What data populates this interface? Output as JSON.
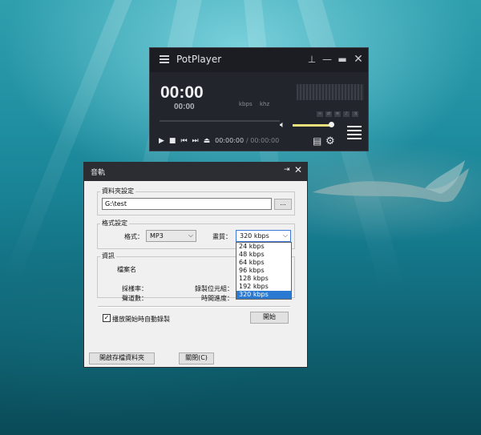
{
  "potplayer": {
    "title": "PotPlayer",
    "time_main": "00:00",
    "time_sub": "00:00",
    "unit_kbps": "kbps",
    "unit_khz": "khz",
    "time_current": "00:00:00",
    "time_total": "/ 00:00:00",
    "volume_level": 0.95,
    "icons": [
      "menu-icon",
      "pin-icon",
      "minimize-icon",
      "maximize-icon",
      "close-icon",
      "play-icon",
      "stop-icon",
      "previous-icon",
      "next-icon",
      "eject-icon",
      "volume-icon",
      "playlist-icon",
      "subtitle-icon",
      "settings-icon"
    ]
  },
  "dialog": {
    "title": "音軌",
    "folder_group": "資料夾設定",
    "folder_path": "G:\\test",
    "browse_label": "...",
    "format_group": "格式設定",
    "format_label": "格式：",
    "format_value": "MP3",
    "quality_label": "畫質：",
    "quality_value": "320 kbps",
    "quality_options": [
      "24 kbps",
      "48 kbps",
      "64 kbps",
      "96 kbps",
      "128 kbps",
      "192 kbps",
      "320 kbps"
    ],
    "info_group": "資訊",
    "filename_label": "檔案名",
    "samplerate_label": "採樣率：",
    "channels_label": "聲道數：",
    "bits_label": "錄製位元組：",
    "progress_label": "時間進度：",
    "auto_record_label": "播放開始時自動錄製",
    "auto_record_checked": true,
    "start_button": "開始",
    "open_folder_button": "開啟存檔資料夾",
    "close_button": "關閉(C)"
  }
}
